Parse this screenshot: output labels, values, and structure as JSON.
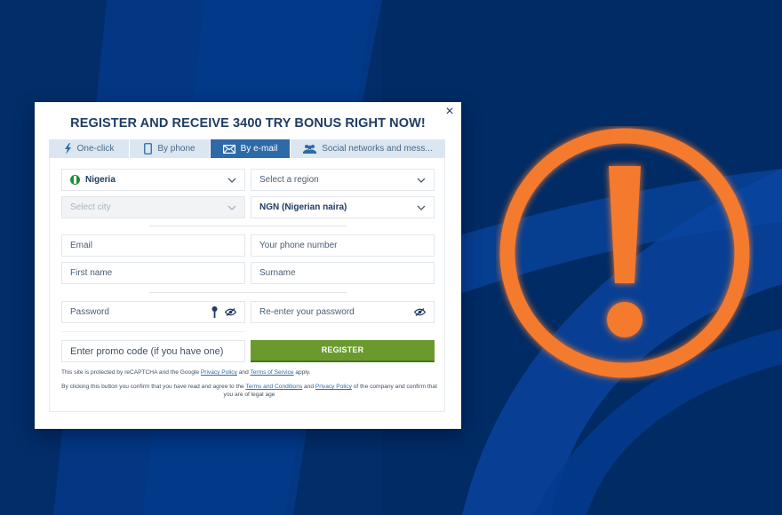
{
  "modal": {
    "title": "REGISTER AND RECEIVE 3400 TRY BONUS RIGHT NOW!",
    "close_label": "×",
    "tabs": [
      {
        "label": "One-click",
        "icon": "lightning-icon",
        "active": false
      },
      {
        "label": "By phone",
        "icon": "phone-icon",
        "active": false
      },
      {
        "label": "By e-mail",
        "icon": "envelope-icon",
        "active": true
      },
      {
        "label": "Social networks and mess...",
        "icon": "users-icon",
        "active": false
      }
    ],
    "form": {
      "country": {
        "value": "Nigeria",
        "icon": "nigeria-flag-icon"
      },
      "region": {
        "placeholder": "Select a region"
      },
      "city": {
        "placeholder": "Select city",
        "disabled": true
      },
      "currency": {
        "value": "NGN (Nigerian naira)"
      },
      "email": {
        "placeholder": "Email"
      },
      "phone": {
        "placeholder": "Your phone number"
      },
      "first_name": {
        "placeholder": "First name"
      },
      "surname": {
        "placeholder": "Surname"
      },
      "password": {
        "placeholder": "Password"
      },
      "password_confirm": {
        "placeholder": "Re-enter your password"
      },
      "promo": {
        "placeholder": "Enter promo code (if you have one)"
      },
      "register_label": "REGISTER"
    },
    "notes": {
      "recaptcha_prefix": "This site is protected by reCAPTCHA and the Google ",
      "privacy_policy": "Privacy Policy",
      "and": " and ",
      "terms_of_service": "Terms of Service",
      "recaptcha_suffix": " apply.",
      "agree_prefix": "By clicking this button you confirm that you have read and agree to the ",
      "terms_and_conditions": "Terms and Conditions",
      "agree_and": " and ",
      "privacy_policy_2": "Privacy Policy",
      "agree_suffix": " of the company and confirm that you are of legal age"
    }
  },
  "colors": {
    "background": "#012a63",
    "accent": "#2e6aa8",
    "register": "#6a9a2e",
    "alert": "#f47a2f",
    "title": "#1f3c64"
  },
  "decoration": {
    "alert_icon": "exclamation-circle-icon"
  }
}
